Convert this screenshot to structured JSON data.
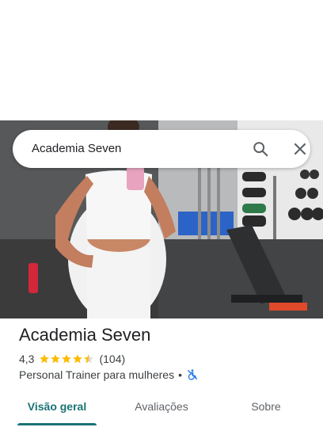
{
  "search": {
    "query": "Academia Seven"
  },
  "place": {
    "name": "Academia Seven",
    "rating": "4,3",
    "stars": 4.5,
    "review_count": "(104)",
    "category": "Personal Trainer para mulheres",
    "separator": "•"
  },
  "tabs": [
    {
      "label": "Visão geral",
      "active": true
    },
    {
      "label": "Avaliações",
      "active": false
    },
    {
      "label": "Sobre",
      "active": false
    }
  ],
  "colors": {
    "accent": "#1a7375",
    "star": "#fbbc04",
    "accessibility_icon": "#1a73e8"
  }
}
